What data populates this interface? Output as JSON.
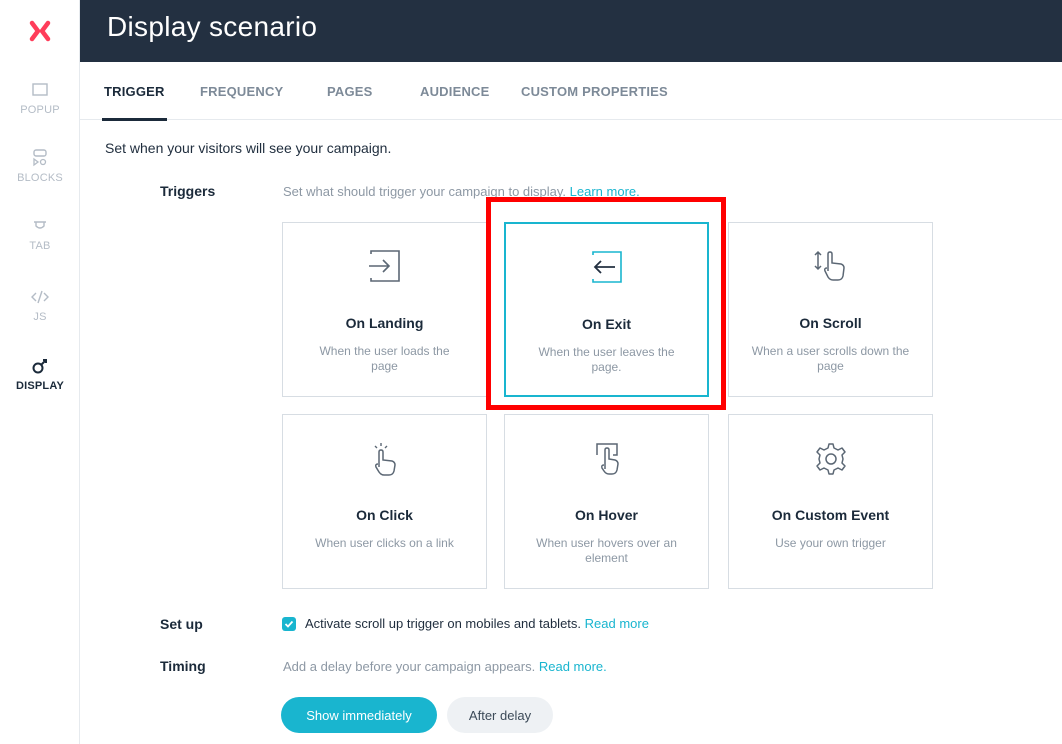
{
  "header": {
    "title": "Display scenario"
  },
  "sidebar": {
    "items": [
      {
        "label": "POPUP"
      },
      {
        "label": "BLOCKS"
      },
      {
        "label": "TAB"
      },
      {
        "label": "JS"
      },
      {
        "label": "DISPLAY",
        "active": true
      }
    ]
  },
  "tabs": [
    {
      "label": "TRIGGER",
      "active": true
    },
    {
      "label": "FREQUENCY"
    },
    {
      "label": "PAGES"
    },
    {
      "label": "AUDIENCE"
    },
    {
      "label": "CUSTOM PROPERTIES"
    }
  ],
  "intro": "Set when your visitors will see your campaign.",
  "triggers": {
    "label": "Triggers",
    "description": "Set what should trigger your campaign to display.",
    "link": "Learn more.",
    "cards": [
      {
        "title": "On Landing",
        "desc": "When the user loads the page",
        "icon": "enter-icon"
      },
      {
        "title": "On Exit",
        "desc": "When the user leaves the page.",
        "icon": "exit-icon",
        "selected": true
      },
      {
        "title": "On Scroll",
        "desc": "When a user scrolls down the page",
        "icon": "scroll-hand-icon"
      },
      {
        "title": "On Click",
        "desc": "When user clicks on a link",
        "icon": "click-hand-icon"
      },
      {
        "title": "On Hover",
        "desc": "When user hovers over an element",
        "icon": "hover-icon"
      },
      {
        "title": "On Custom Event",
        "desc": "Use your own trigger",
        "icon": "gear-icon"
      }
    ]
  },
  "setup": {
    "label": "Set up",
    "checkbox_label": "Activate scroll up trigger on mobiles and tablets.",
    "checked": true,
    "link": "Read more"
  },
  "timing": {
    "label": "Timing",
    "description": "Add a delay before your campaign appears.",
    "link": "Read more.",
    "buttons": [
      {
        "label": "Show immediately",
        "active": true
      },
      {
        "label": "After delay"
      }
    ]
  },
  "colors": {
    "accent": "#19b5cf",
    "header": "#233041",
    "highlight": "#ff0000",
    "logo": "#ff3d5a"
  }
}
